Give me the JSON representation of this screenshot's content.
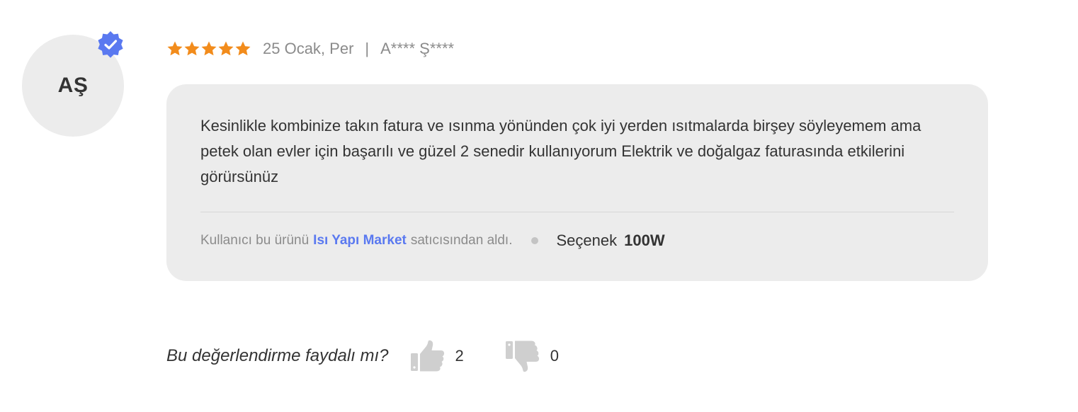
{
  "review": {
    "avatar_initials": "AŞ",
    "verified_icon": "verified-badge-icon",
    "rating": 5,
    "rating_max": 5,
    "star_color": "#f28c1c",
    "date": "25 Ocak, Per",
    "separator": "|",
    "author": "A**** Ş****",
    "comment": "Kesinlikle kombinize takın fatura ve ısınma yönünden çok iyi yerden ısıtmalarda birşey söyleyemem ama petek olan evler için başarılı ve güzel 2 senedir kullanıyorum Elektrik ve doğalgaz faturasında etkilerini görürsünüz",
    "seller_prefix": "Kullanıcı bu ürünü",
    "seller_name": "Isı Yapı Market",
    "seller_suffix": "satıcısından aldı.",
    "option_label": "Seçenek",
    "option_value": "100W"
  },
  "helpful": {
    "question": "Bu değerlendirme faydalı mı?",
    "thumbs_up_icon": "thumbs-up-icon",
    "thumbs_up_count": "2",
    "thumbs_down_icon": "thumbs-down-icon",
    "thumbs_down_count": "0"
  },
  "colors": {
    "accent": "#5a79f0",
    "bubble_bg": "#ececec",
    "verified_badge": "#5a79f0",
    "icon_gray": "#cfcfcf"
  }
}
